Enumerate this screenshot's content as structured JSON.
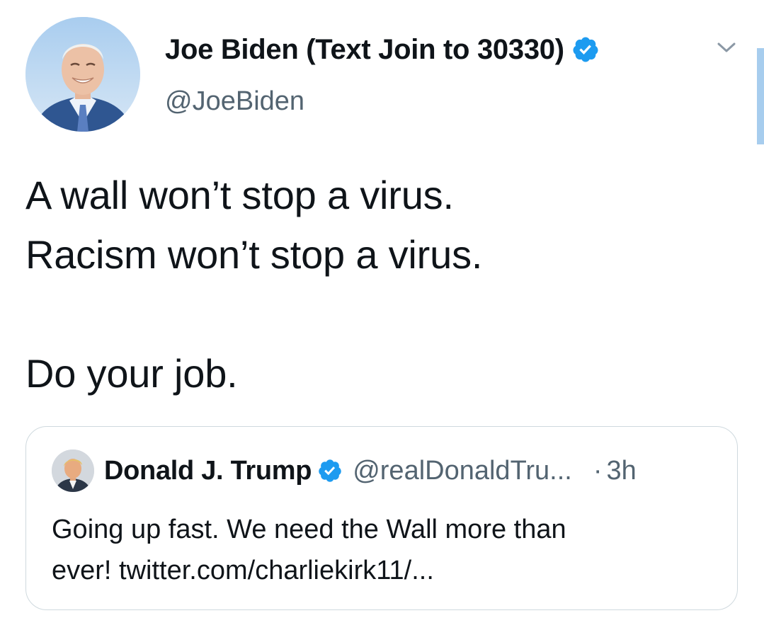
{
  "tweet": {
    "author": {
      "display_name": "Joe Biden (Text Join to 30330)",
      "handle": "@JoeBiden",
      "verified": true
    },
    "text_lines": [
      "A wall won’t stop a virus.",
      "Racism won’t stop a virus.",
      "",
      "Do your job."
    ],
    "menu_icon": "chevron-down-icon"
  },
  "quoted_tweet": {
    "author": {
      "display_name": "Donald J. Trump",
      "handle": "@realDonaldTru...",
      "verified": true
    },
    "separator": "·",
    "time": "3h",
    "text_lines": [
      "Going up fast. We need the Wall more than",
      "ever! twitter.com/charliekirk11/..."
    ]
  },
  "colors": {
    "verified_blue": "#1d9bf0",
    "secondary_text": "#536471",
    "border": "#cfd9de",
    "scroll_indicator": "#a7cdee"
  }
}
